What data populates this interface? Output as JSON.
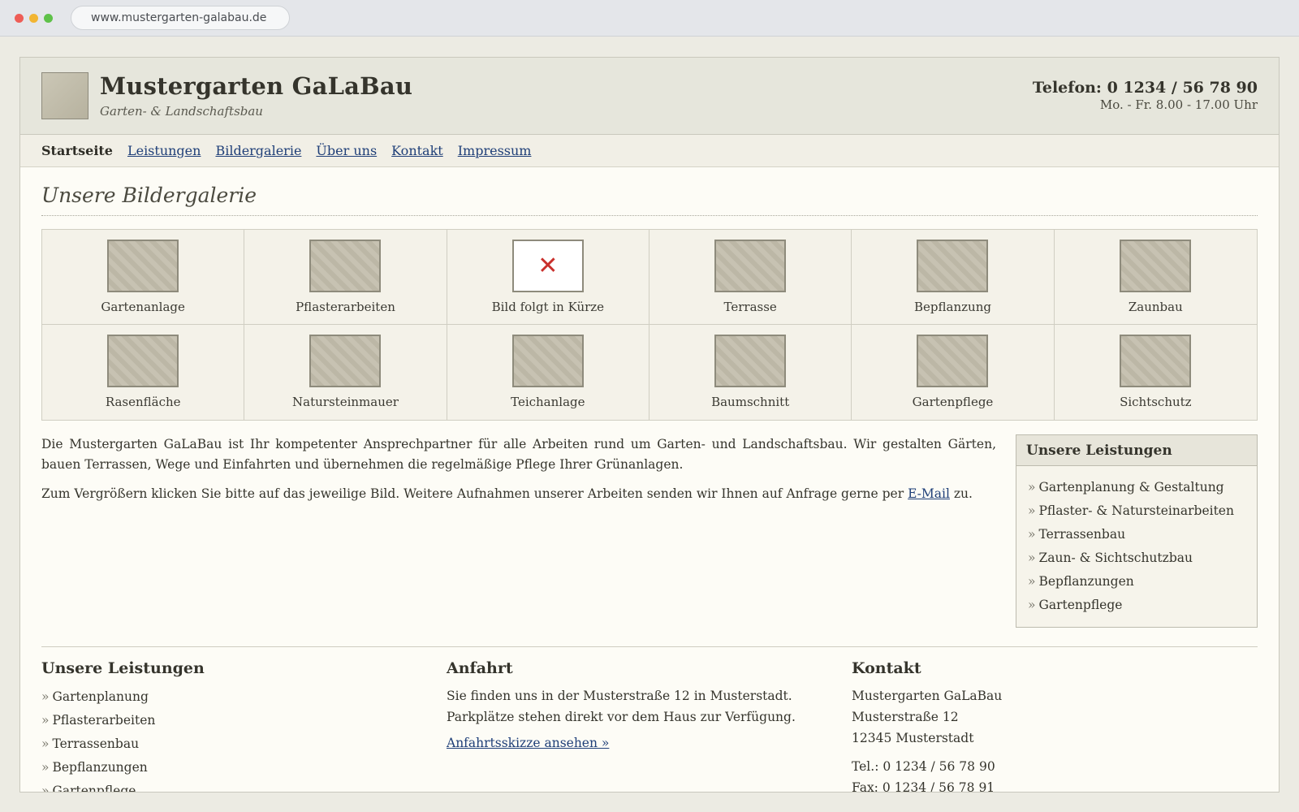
{
  "browser": {
    "url": "www.mustergarten-galabau.de"
  },
  "header": {
    "title": "Mustergarten GaLaBau",
    "subtitle": "Garten- & Landschaftsbau",
    "phone": "Telefon: 0 1234 / 56 78 90",
    "hours": "Mo. - Fr. 8.00 - 17.00 Uhr"
  },
  "nav": {
    "items": [
      {
        "label": "Startseite",
        "active": true
      },
      {
        "label": "Leistungen",
        "active": false
      },
      {
        "label": "Bildergalerie",
        "active": false
      },
      {
        "label": "Über uns",
        "active": false
      },
      {
        "label": "Kontakt",
        "active": false
      },
      {
        "label": "Impressum",
        "active": false
      }
    ]
  },
  "main": {
    "heading": "Unsere Bildergalerie",
    "gallery": [
      {
        "caption": "Gartenanlage",
        "missing": false
      },
      {
        "caption": "Pflasterarbeiten",
        "missing": false
      },
      {
        "caption": "Bild folgt in Kürze",
        "missing": true
      },
      {
        "caption": "Terrasse",
        "missing": false
      },
      {
        "caption": "Bepflanzung",
        "missing": false
      },
      {
        "caption": "Zaunbau",
        "missing": false
      },
      {
        "caption": "Rasenfläche",
        "missing": false
      },
      {
        "caption": "Natursteinmauer",
        "missing": false
      },
      {
        "caption": "Teichanlage",
        "missing": false
      },
      {
        "caption": "Baumschnitt",
        "missing": false
      },
      {
        "caption": "Gartenpflege",
        "missing": false
      },
      {
        "caption": "Sichtschutz",
        "missing": false
      }
    ],
    "intro_paragraph_1": "Die Mustergarten GaLaBau ist Ihr kompetenter Ansprechpartner für alle Arbeiten rund um Garten- und Landschaftsbau. Wir gestalten Gärten, bauen Terrassen, Wege und Einfahrten und übernehmen die regelmäßige Pflege Ihrer Grünanlagen.",
    "intro_paragraph_2_before": "Zum Vergrößern klicken Sie bitte auf das jeweilige Bild. Weitere Aufnahmen unserer Arbeiten senden wir Ihnen auf Anfrage gerne per ",
    "intro_paragraph_2_link": "E-Mail",
    "intro_paragraph_2_after": " zu."
  },
  "sidebar": {
    "title": "Unsere Leistungen",
    "items": [
      "Gartenplanung & Gestaltung",
      "Pflaster- & Natursteinarbeiten",
      "Terrassenbau",
      "Zaun- & Sichtschutzbau",
      "Bepflanzungen",
      "Gartenpflege"
    ]
  },
  "footer": {
    "services": {
      "title": "Unsere Leistungen",
      "items": [
        "Gartenplanung",
        "Pflasterarbeiten",
        "Terrassenbau",
        "Bepflanzungen",
        "Gartenpflege"
      ]
    },
    "directions": {
      "title": "Anfahrt",
      "text": "Sie finden uns in der Musterstraße 12 in Musterstadt. Parkplätze stehen direkt vor dem Haus zur Verfügung.",
      "link": "Anfahrtsskizze ansehen »"
    },
    "contact": {
      "title": "Kontakt",
      "lines": [
        "Mustergarten GaLaBau",
        "Musterstraße 12",
        "12345 Musterstadt"
      ],
      "tel": "Tel.: 0 1234 / 56 78 90",
      "fax": "Fax: 0 1234 / 56 78 91"
    }
  },
  "colors": {
    "link": "#1f3f78",
    "header_bg": "#e6e6dc",
    "page_bg": "#fdfcf6",
    "missing_mark": "#c9302c"
  }
}
